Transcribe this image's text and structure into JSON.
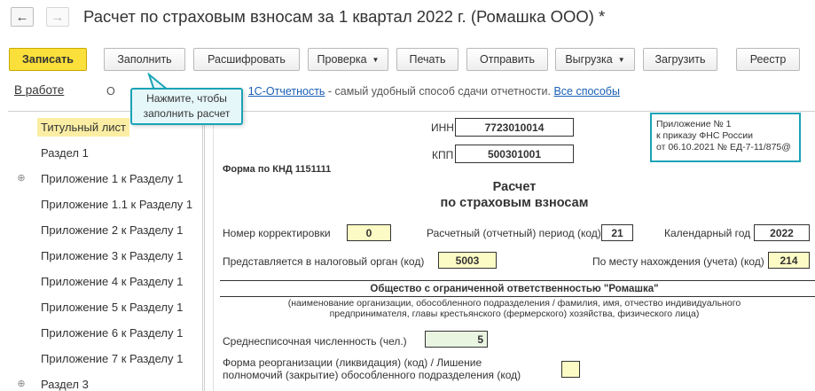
{
  "window": {
    "title": "Расчет по страховым взносам за 1 квартал 2022 г. (Ромашка ООО) *",
    "nav_back": "←",
    "nav_forward": "→"
  },
  "toolbar": {
    "save": "Записать",
    "fill": "Заполнить",
    "decode": "Расшифровать",
    "check": "Проверка",
    "print": "Печать",
    "send": "Отправить",
    "export": "Выгрузка",
    "load": "Загрузить",
    "registry": "Реестр"
  },
  "status": {
    "state": "В работе",
    "hint_prefix": "О",
    "hint_link": "1С-Отчетность",
    "hint_text": " - самый удобный способ сдачи отчетности. ",
    "hint_all": "Все способы"
  },
  "tooltip": {
    "line1": "Нажмите, чтобы",
    "line2": "заполнить расчет"
  },
  "sidebar": {
    "items": [
      {
        "label": "Титульный лист",
        "selected": true,
        "expandable": false
      },
      {
        "label": "Раздел 1",
        "selected": false,
        "expandable": false
      },
      {
        "label": "Приложение 1 к Разделу 1",
        "selected": false,
        "expandable": true
      },
      {
        "label": "Приложение 1.1 к Разделу 1",
        "selected": false,
        "expandable": false
      },
      {
        "label": "Приложение 2 к Разделу 1",
        "selected": false,
        "expandable": false
      },
      {
        "label": "Приложение 3 к Разделу 1",
        "selected": false,
        "expandable": false
      },
      {
        "label": "Приложение 4 к Разделу 1",
        "selected": false,
        "expandable": false
      },
      {
        "label": "Приложение 5 к Разделу 1",
        "selected": false,
        "expandable": false
      },
      {
        "label": "Приложение 6 к Разделу 1",
        "selected": false,
        "expandable": false
      },
      {
        "label": "Приложение 7 к Разделу 1",
        "selected": false,
        "expandable": false
      },
      {
        "label": "Раздел 3",
        "selected": false,
        "expandable": true
      }
    ]
  },
  "form": {
    "inn_label": "ИНН",
    "inn_value": "7723010014",
    "kpp_label": "КПП",
    "kpp_value": "500301001",
    "knd": "Форма по КНД 1151111",
    "appendix": {
      "line1": "Приложение № 1",
      "line2": "к приказу ФНС России",
      "line3": "от 06.10.2021 № ЕД-7-11/875@"
    },
    "heading_line1": "Расчет",
    "heading_line2": "по страховым взносам",
    "correction_label": "Номер корректировки",
    "correction_value": "0",
    "period_label": "Расчетный (отчетный) период (код)",
    "period_value": "21",
    "year_label": "Календарный год",
    "year_value": "2022",
    "tax_org_label": "Представляется в налоговый орган (код)",
    "tax_org_value": "5003",
    "location_label": "По месту нахождения (учета) (код)",
    "location_value": "214",
    "org_name": "Общество с ограниченной ответственностью \"Ромашка\"",
    "org_note_line1": "(наименование организации, обособленного подразделения / фамилия, имя, отчество индивидуального",
    "org_note_line2": "предпринимателя, главы крестьянского (фермерского) хозяйства, физического лица)",
    "headcount_label": "Среднесписочная численность (чел.)",
    "headcount_value": "5",
    "reorg_label_line1": "Форма реорганизации (ликвидация) (код) / Лишение",
    "reorg_label_line2": "полномочий (закрытие) обособленного подразделения (код)",
    "reorg_value": ""
  },
  "colors": {
    "primary_button": "#fbe03b",
    "accent": "#1aa3b6",
    "selected_item": "#fbeea4",
    "input_yellow": "#fdfbc5",
    "input_green": "#e9f5e1",
    "link": "#1a5fb4"
  }
}
